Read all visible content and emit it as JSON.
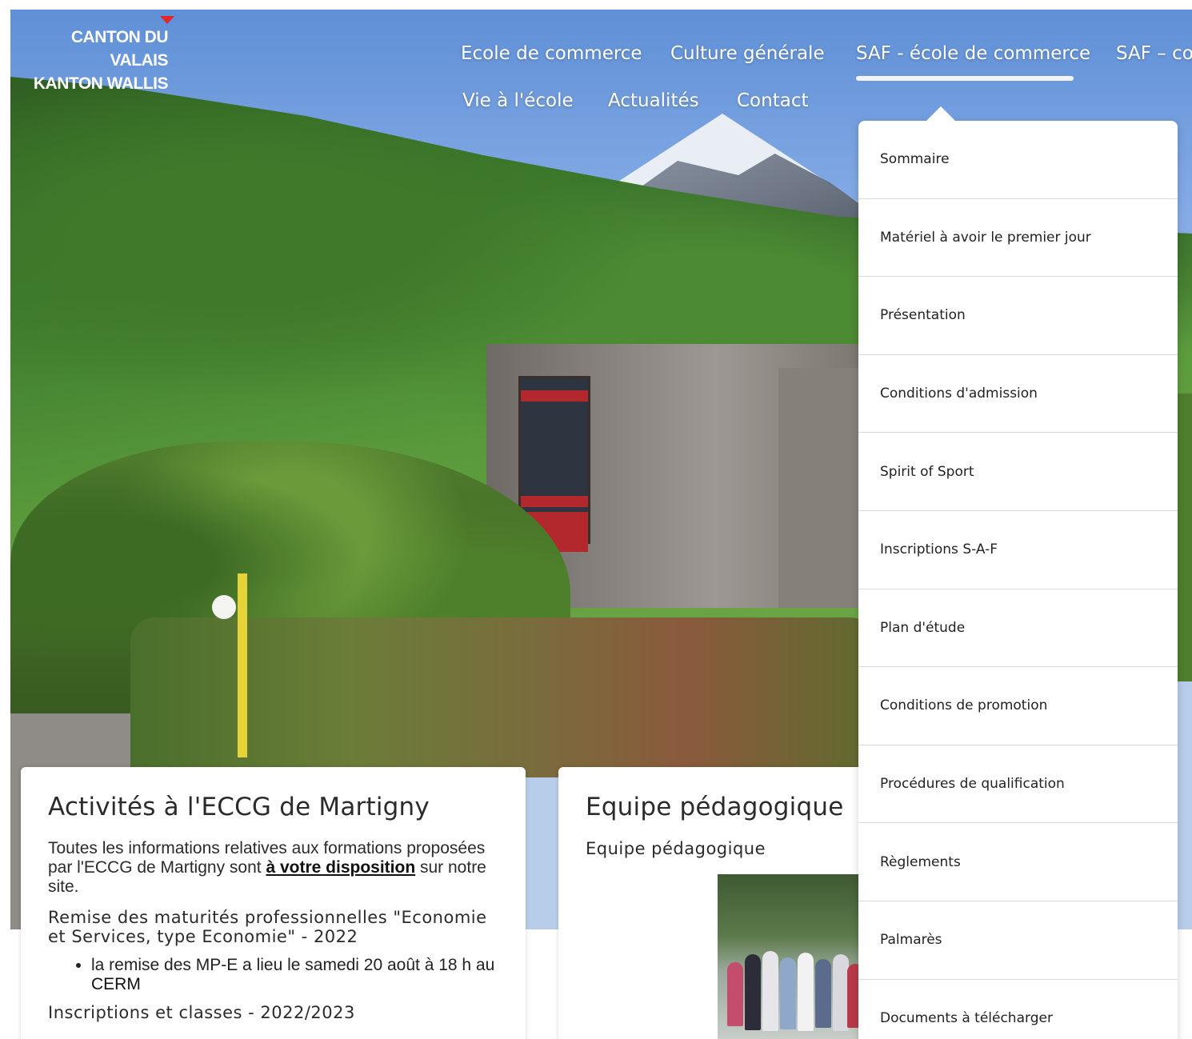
{
  "logo": {
    "line1": "CANTON DU VALAIS",
    "line2": "KANTON WALLIS"
  },
  "nav": {
    "items": [
      {
        "label": "Ecole de commerce"
      },
      {
        "label": "Culture générale"
      },
      {
        "label": "SAF - école de commerce",
        "active": true
      },
      {
        "label": "SAF – co"
      },
      {
        "label": "Vie à l'école"
      },
      {
        "label": "Actualités"
      },
      {
        "label": "Contact"
      }
    ]
  },
  "dropdown": {
    "items": [
      "Sommaire",
      "Matériel à avoir le premier jour",
      "Présentation",
      "Conditions d'admission",
      "Spirit of Sport",
      "Inscriptions S-A-F",
      "Plan d'étude",
      "Conditions de promotion",
      "Procédures de qualification",
      "Règlements",
      "Palmarès",
      "Documents à télécharger"
    ]
  },
  "card_left": {
    "title": "Activités à l'ECCG de Martigny",
    "intro_before": "Toutes les informations relatives aux formations proposées par l'ECCG de Martigny sont ",
    "intro_link": "à votre disposition",
    "intro_after": " sur notre site.",
    "section1_title": "Remise des maturités professionnelles \"Economie et Services, type Economie\" - 2022",
    "section1_bullet_before": "la remise des MP-E a lieu le samedi 20 août à 18 h au ",
    "section1_bullet_link": "CERM",
    "section2_title": "Inscriptions et classes - 2022/2023"
  },
  "card_right": {
    "title": "Equipe pédagogique",
    "subtitle": "Equipe pédagogique"
  },
  "colors": {
    "nav_text": "#ffffff",
    "accent_flag": "#e3262b",
    "card_bg": "#ffffff"
  }
}
